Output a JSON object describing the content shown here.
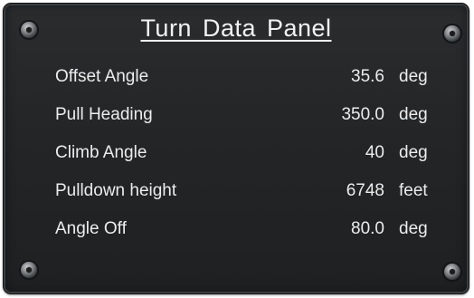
{
  "panel": {
    "title": "Turn Data Panel"
  },
  "rows": [
    {
      "label": "Offset Angle",
      "value": "35.6",
      "unit": "deg"
    },
    {
      "label": "Pull Heading",
      "value": "350.0",
      "unit": "deg"
    },
    {
      "label": "Climb Angle",
      "value": "40",
      "unit": "deg"
    },
    {
      "label": "Pulldown height",
      "value": "6748",
      "unit": "feet"
    },
    {
      "label": "Angle Off",
      "value": "80.0",
      "unit": "deg"
    }
  ]
}
